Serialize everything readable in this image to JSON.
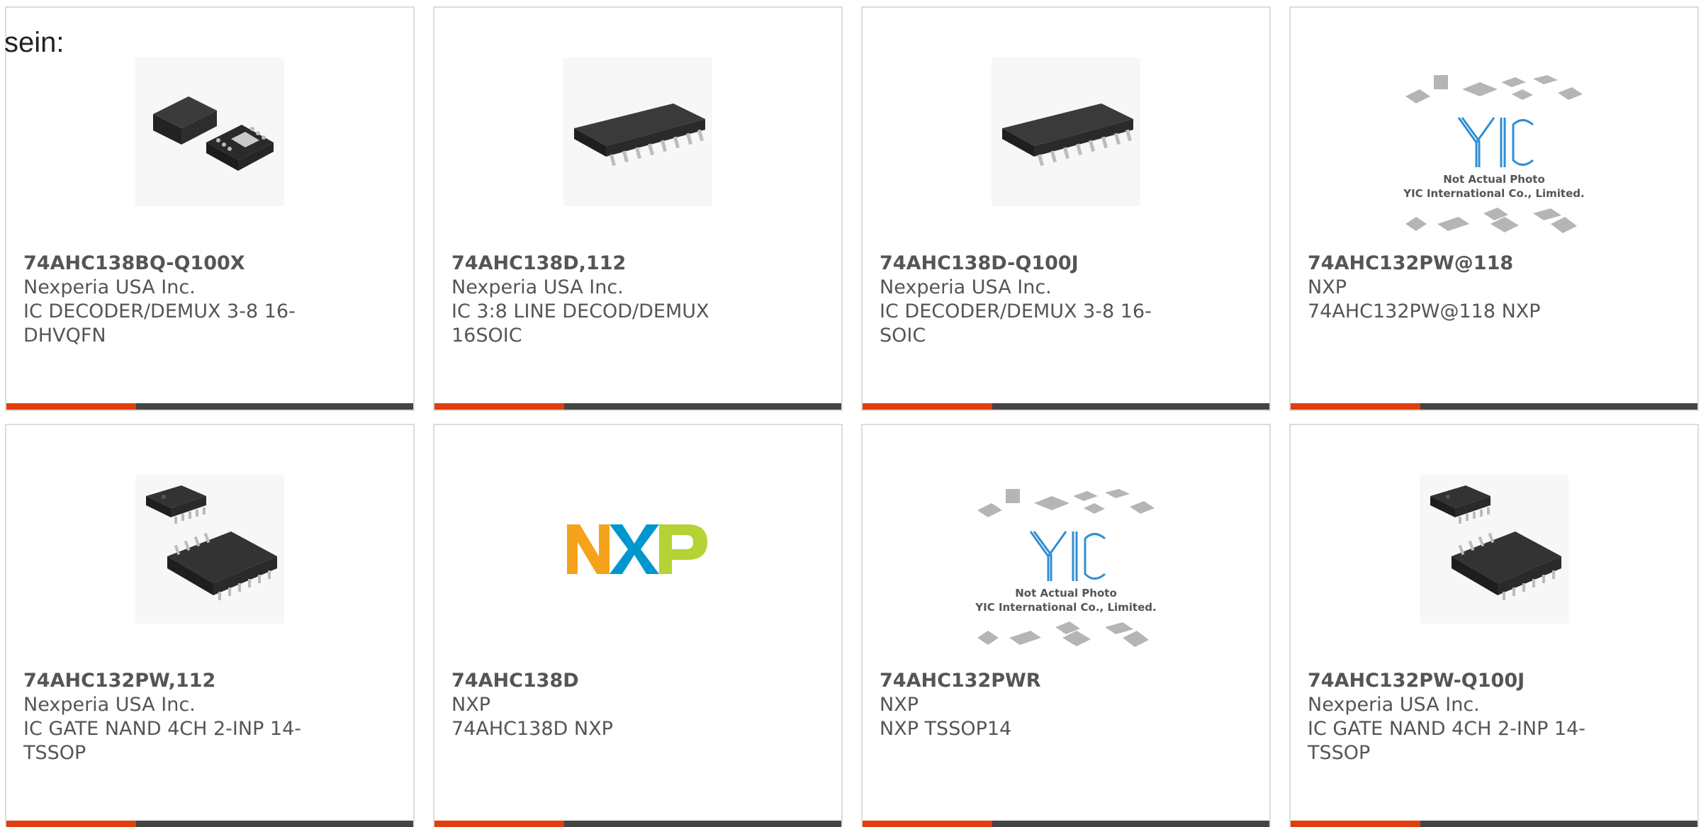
{
  "prefix_text": "sein:",
  "colors": {
    "accent": "#e23d0f",
    "bar": "#444444",
    "yic_blue": "#2f8fd4",
    "nxp_orange": "#f5a31a",
    "nxp_blue": "#0097cf",
    "nxp_green": "#b5d334"
  },
  "cards": [
    {
      "image": "qfn-chip-image",
      "part": "74AHC138BQ-Q100X",
      "maker": "Nexperia USA Inc.",
      "desc1": "IC DECODER/DEMUX 3-8 16-",
      "desc2": "DHVQFN"
    },
    {
      "image": "soic-chip-image",
      "part": "74AHC138D,112",
      "maker": "Nexperia USA Inc.",
      "desc1": "IC 3:8 LINE DECOD/DEMUX",
      "desc2": "16SOIC"
    },
    {
      "image": "soic-chip-image",
      "part": "74AHC138D-Q100J",
      "maker": "Nexperia USA Inc.",
      "desc1": "IC DECODER/DEMUX 3-8 16-",
      "desc2": "SOIC"
    },
    {
      "image": "yic-placeholder-image",
      "part": "74AHC132PW@118",
      "maker": "NXP",
      "desc1": "74AHC132PW@118 NXP",
      "desc2": "",
      "placeholder_line1": "Not Actual Photo",
      "placeholder_line2": "YIC International Co., Limited."
    },
    {
      "image": "tssop-chip-image",
      "part": "74AHC132PW,112",
      "maker": "Nexperia USA Inc.",
      "desc1": "IC GATE NAND 4CH 2-INP 14-",
      "desc2": "TSSOP"
    },
    {
      "image": "nxp-logo-image",
      "part": "74AHC138D",
      "maker": "NXP",
      "desc1": "74AHC138D NXP",
      "desc2": ""
    },
    {
      "image": "yic-placeholder-image",
      "part": "74AHC132PWR",
      "maker": "NXP",
      "desc1": "NXP TSSOP14",
      "desc2": "",
      "placeholder_line1": "Not Actual Photo",
      "placeholder_line2": "YIC International Co., Limited."
    },
    {
      "image": "tssop-chip-image",
      "part": "74AHC132PW-Q100J",
      "maker": "Nexperia USA Inc.",
      "desc1": "IC GATE NAND 4CH 2-INP 14-",
      "desc2": "TSSOP"
    }
  ]
}
